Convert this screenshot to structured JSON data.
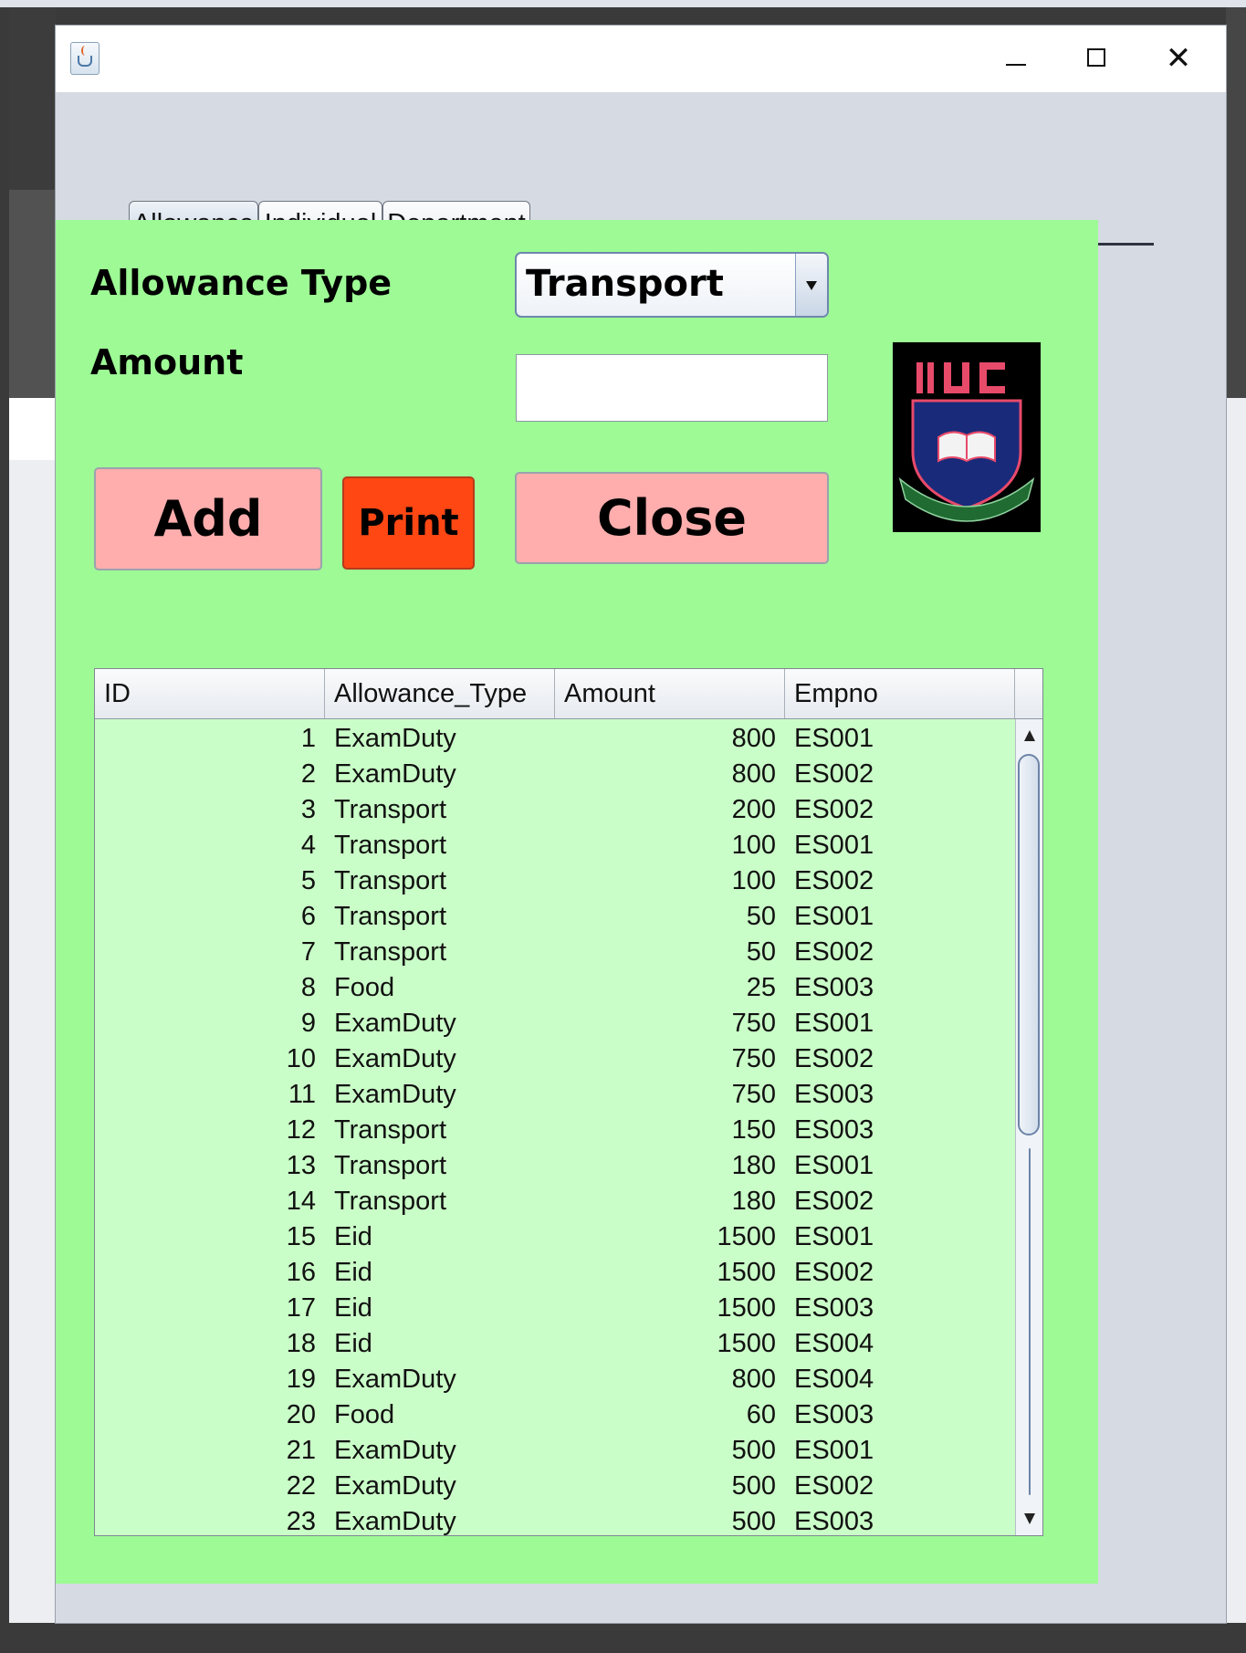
{
  "tabs": [
    {
      "label": "Allowance",
      "active": true
    },
    {
      "label": "Individual",
      "active": false
    },
    {
      "label": "Department",
      "active": false
    }
  ],
  "form": {
    "allowance_type_label": "Allowance Type",
    "allowance_type_value": "Transport",
    "amount_label": "Amount",
    "amount_value": ""
  },
  "buttons": {
    "add": "Add",
    "print": "Print",
    "close": "Close"
  },
  "logo": {
    "text": "IIUC",
    "colors": {
      "background": "#000000",
      "shield": "#1a2a7a",
      "accent": "#e84a6a",
      "ribbon": "#1f6b32"
    }
  },
  "table": {
    "columns": [
      "ID",
      "Allowance_Type",
      "Amount",
      "Empno"
    ],
    "rows": [
      [
        "1",
        "ExamDuty",
        "800",
        "ES001"
      ],
      [
        "2",
        "ExamDuty",
        "800",
        "ES002"
      ],
      [
        "3",
        "Transport",
        "200",
        "ES002"
      ],
      [
        "4",
        "Transport",
        "100",
        "ES001"
      ],
      [
        "5",
        "Transport",
        "100",
        "ES002"
      ],
      [
        "6",
        "Transport",
        "50",
        "ES001"
      ],
      [
        "7",
        "Transport",
        "50",
        "ES002"
      ],
      [
        "8",
        "Food",
        "25",
        "ES003"
      ],
      [
        "9",
        "ExamDuty",
        "750",
        "ES001"
      ],
      [
        "10",
        "ExamDuty",
        "750",
        "ES002"
      ],
      [
        "11",
        "ExamDuty",
        "750",
        "ES003"
      ],
      [
        "12",
        "Transport",
        "150",
        "ES003"
      ],
      [
        "13",
        "Transport",
        "180",
        "ES001"
      ],
      [
        "14",
        "Transport",
        "180",
        "ES002"
      ],
      [
        "15",
        "Eid",
        "1500",
        "ES001"
      ],
      [
        "16",
        "Eid",
        "1500",
        "ES002"
      ],
      [
        "17",
        "Eid",
        "1500",
        "ES003"
      ],
      [
        "18",
        "Eid",
        "1500",
        "ES004"
      ],
      [
        "19",
        "ExamDuty",
        "800",
        "ES004"
      ],
      [
        "20",
        "Food",
        "60",
        "ES003"
      ],
      [
        "21",
        "ExamDuty",
        "500",
        "ES001"
      ],
      [
        "22",
        "ExamDuty",
        "500",
        "ES002"
      ],
      [
        "23",
        "ExamDuty",
        "500",
        "ES003"
      ]
    ]
  },
  "colors": {
    "panel_green": "#9dfa95",
    "table_green": "#cafec8",
    "add_button": "#ffadad",
    "print_button": "#ff4714",
    "close_button": "#ffadad",
    "window_bg": "#d6dae3"
  },
  "icons": {
    "window_icon": "java-cup-icon",
    "minimize": "minimize-icon",
    "maximize": "maximize-icon",
    "close": "close-icon"
  }
}
